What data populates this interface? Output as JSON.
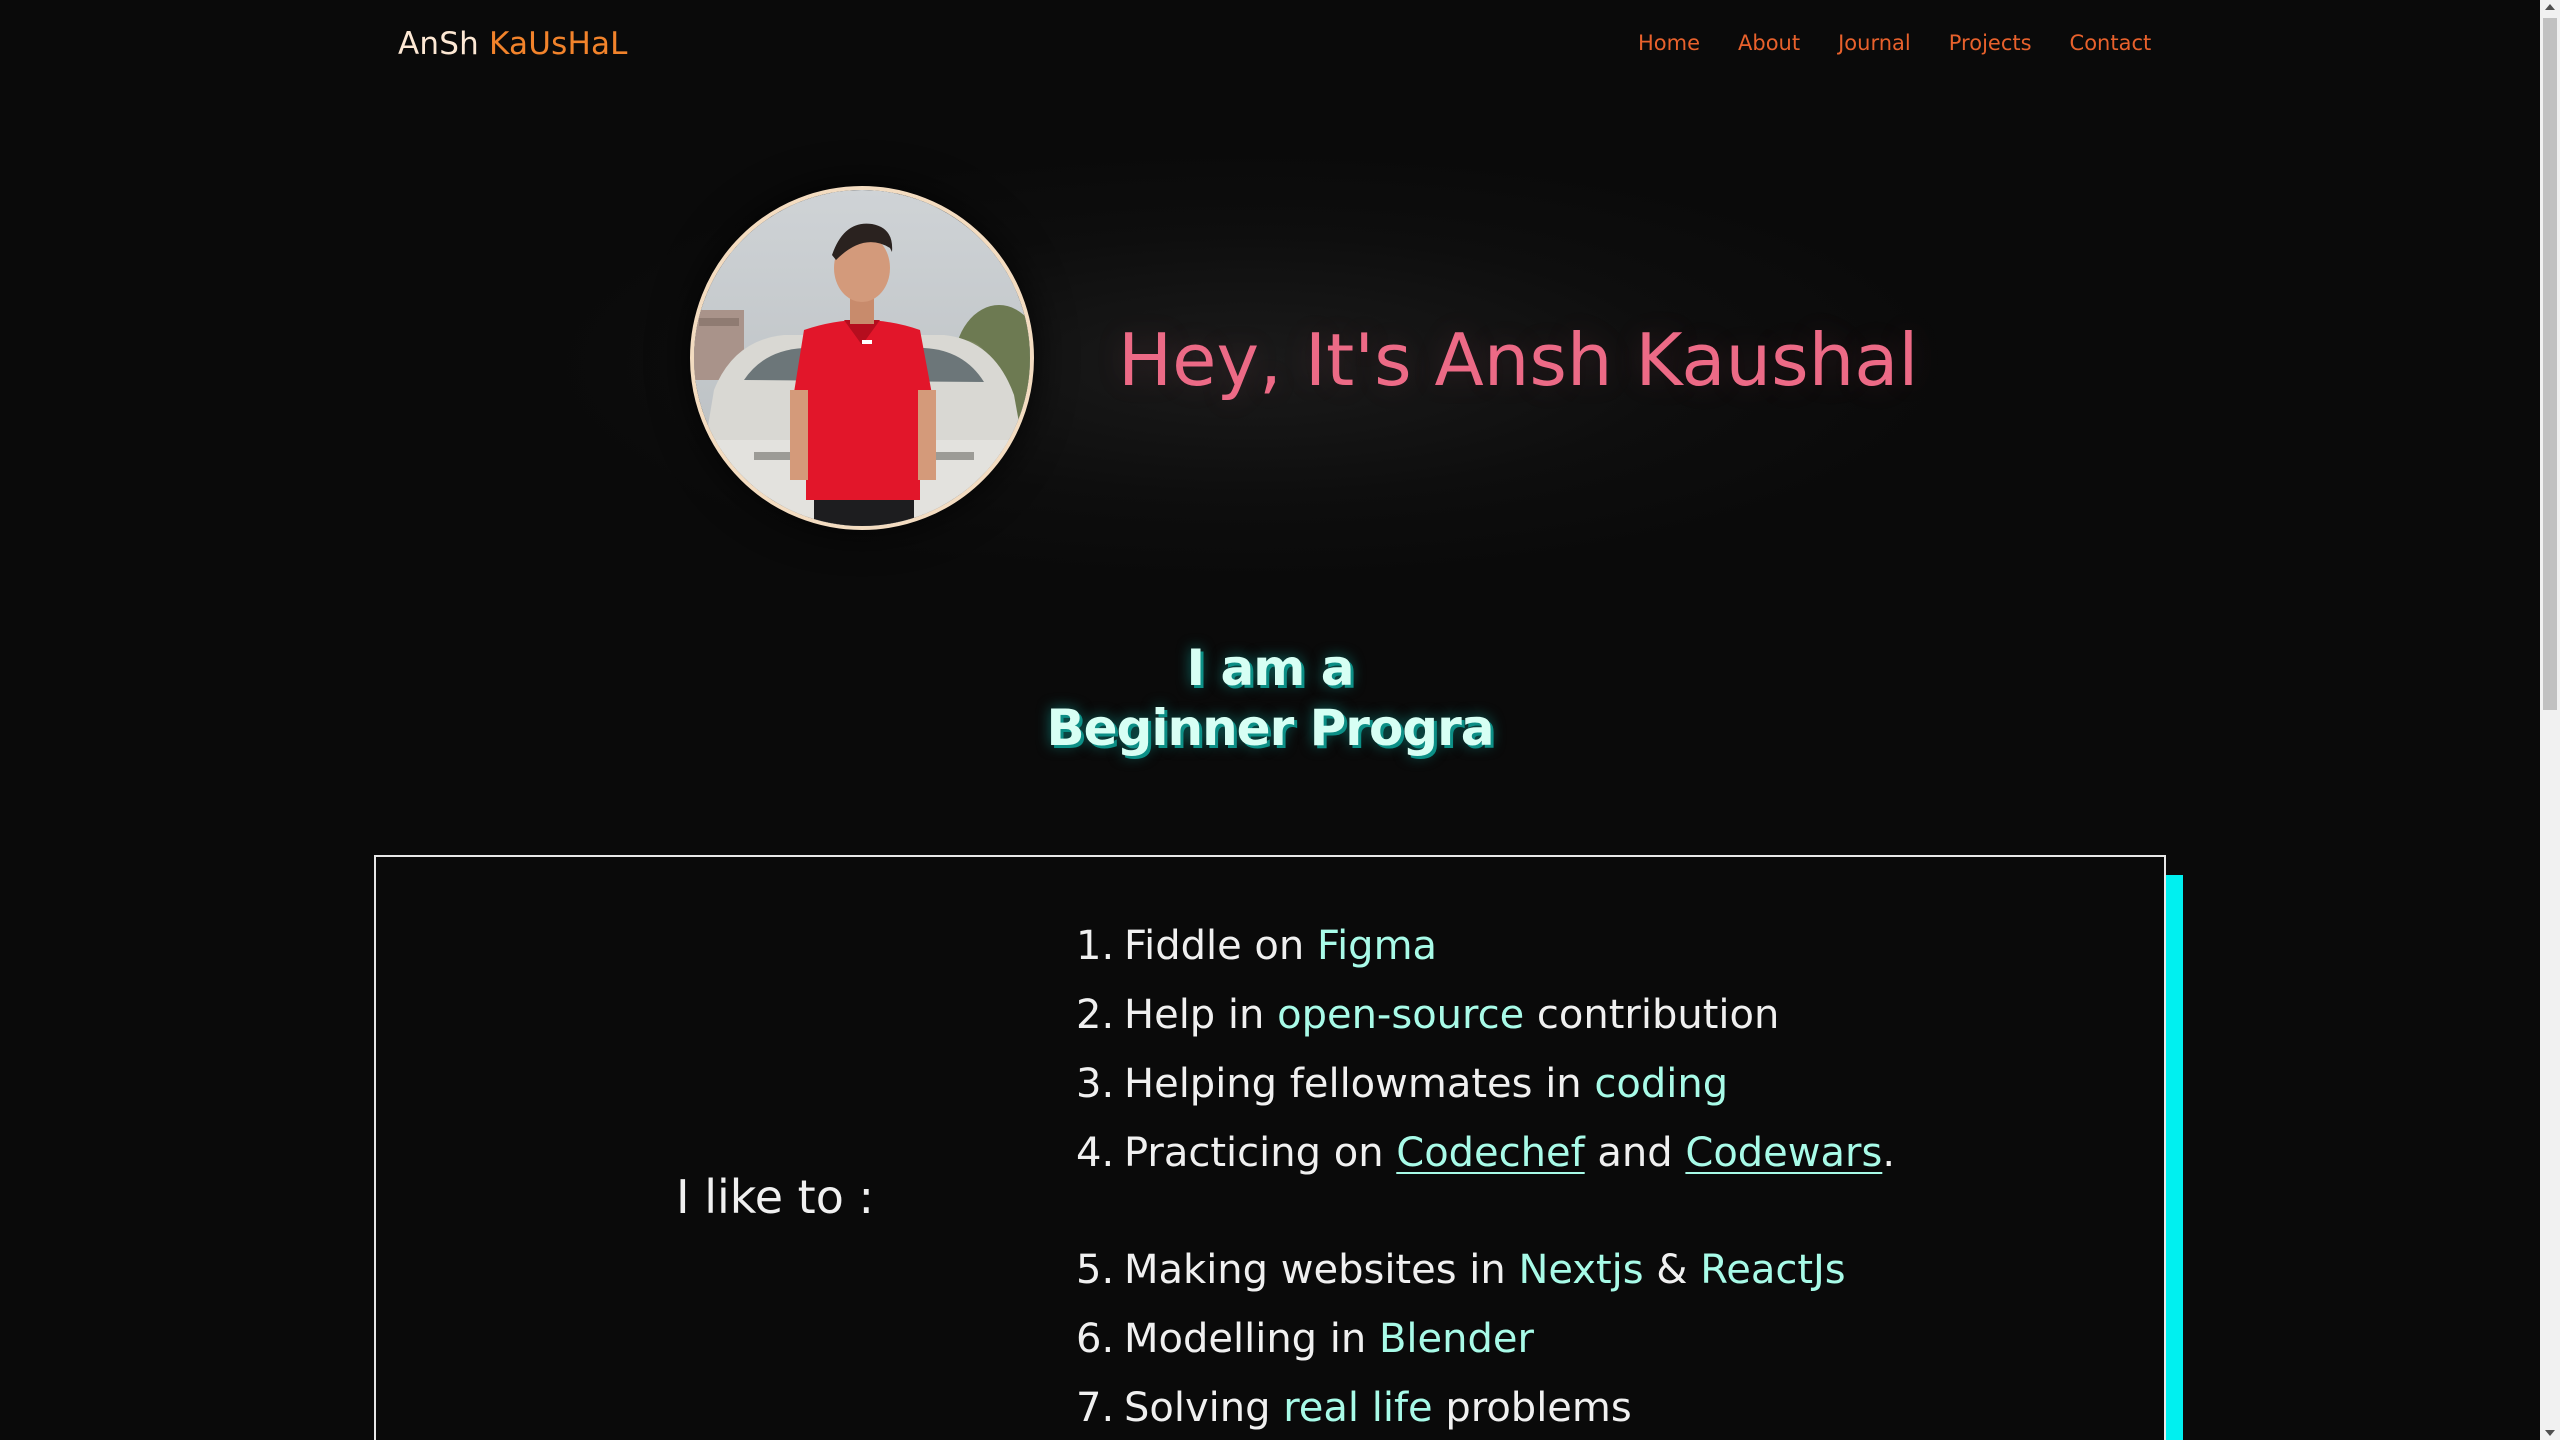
{
  "brand": {
    "first": "AnSh ",
    "last": "KaUsHaL"
  },
  "nav": {
    "items": [
      {
        "label": "Home"
      },
      {
        "label": "About"
      },
      {
        "label": "Journal"
      },
      {
        "label": "Projects"
      },
      {
        "label": "Contact"
      }
    ]
  },
  "hero": {
    "title": "Hey, It's Ansh Kaushal"
  },
  "typing": {
    "line1": "I am a",
    "line2": "Beginner Progra"
  },
  "likes": {
    "heading": "I like to :",
    "items": [
      {
        "num": "1.",
        "parts": [
          "Fiddle on ",
          "Figma",
          ""
        ]
      },
      {
        "num": "2.",
        "parts": [
          "Help in ",
          "open-source",
          " contribution"
        ]
      },
      {
        "num": "3.",
        "parts": [
          "Helping fellowmates in ",
          "coding",
          ""
        ]
      },
      {
        "num": "4.",
        "parts": [
          "Practicing on ",
          "Codechef",
          " and ",
          "Codewars",
          "."
        ]
      },
      {
        "num": "5.",
        "parts": [
          "Making websites in ",
          "Nextjs",
          " & ",
          "ReactJs",
          ""
        ]
      },
      {
        "num": "6.",
        "parts": [
          "Modelling in ",
          "Blender",
          ""
        ]
      },
      {
        "num": "7.",
        "parts": [
          "Solving ",
          "real life",
          " problems"
        ]
      }
    ]
  },
  "colors": {
    "background": "#0a0a0a",
    "nav_link": "#e8612c",
    "hero_title": "#ec6a86",
    "highlight": "#a8fbe8",
    "accent_bar": "#00f0f0"
  }
}
